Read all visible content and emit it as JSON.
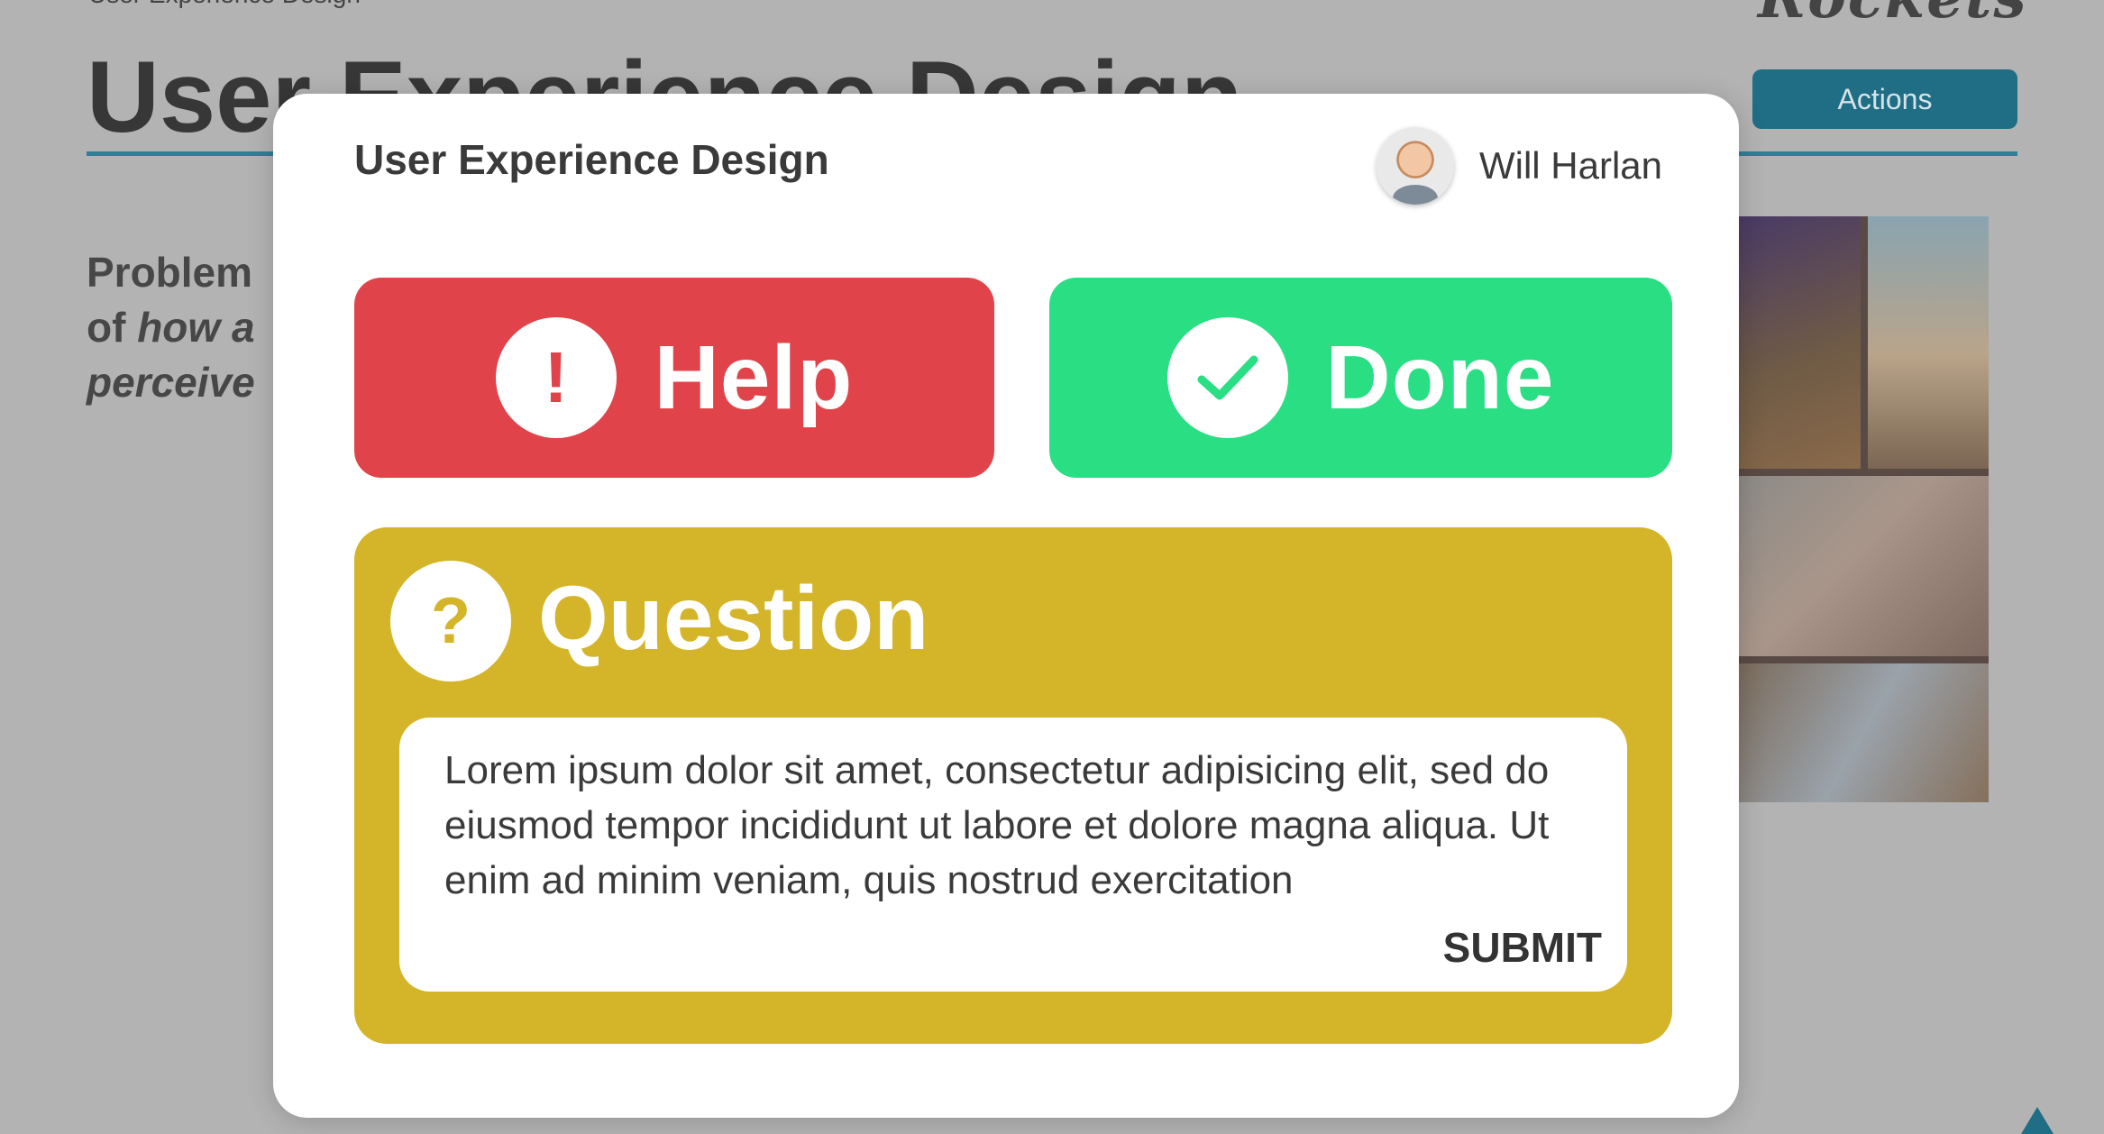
{
  "background": {
    "breadcrumb": "User Experience Design",
    "logo_text": "Rockets",
    "title": "User Experience Design",
    "actions_label": "Actions",
    "paragraph": {
      "line1": "Problem",
      "line2_a": "of ",
      "line2_b": "how a",
      "line3": "perceive"
    }
  },
  "modal": {
    "title": "User Experience Design",
    "user_name": "Will Harlan",
    "help": {
      "icon": "exclamation-icon",
      "glyph": "!",
      "label": "Help",
      "color": "#e0444a"
    },
    "done": {
      "icon": "check-icon",
      "label": "Done",
      "color": "#2ade84"
    },
    "question": {
      "icon": "question-icon",
      "glyph": "?",
      "title": "Question",
      "text": "Lorem ipsum dolor sit amet, consectetur adipisicing elit, sed do eiusmod tempor incididunt ut labore et dolore magna aliqua. Ut enim ad minim veniam, quis nostrud exercitation",
      "submit_label": "SUBMIT",
      "color": "#d4b52a"
    }
  }
}
